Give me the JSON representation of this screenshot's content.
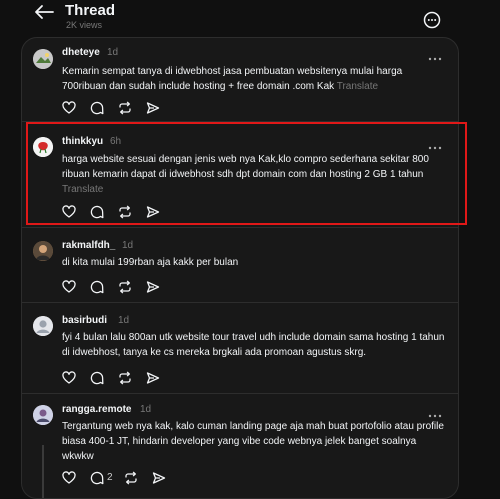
{
  "header": {
    "title": "Thread",
    "views": "2K views"
  },
  "posts": [
    {
      "username": "dheteye",
      "time": "1d",
      "text": "Kemarin sempat tanya di idwebhost jasa pembuatan websitenya mulai harga 700ribuan dan sudah include hosting + free domain .com Kak",
      "translate": "Translate"
    },
    {
      "username": "thinkkyu",
      "time": "6h",
      "text": "harga website sesuai dengan jenis web nya Kak,klo compro sederhana sekitar 800 ribuan kemarin dapat di idwebhost sdh dpt domain com dan hosting 2 GB 1 tahun",
      "translate": "Translate"
    },
    {
      "username": "rakmalfdh_",
      "time": "1d",
      "text": "di kita mulai 199rban aja kakk per bulan"
    },
    {
      "username": "basirbudi",
      "time": "1d",
      "text": "fyi 4 bulan lalu 800an utk website tour travel udh include domain sama hosting 1 tahun di idwebhost, tanya ke cs mereka brgkali ada promoan agustus skrg."
    },
    {
      "username": "rangga.remote",
      "time": "1d",
      "text": "Tergantung web nya kak, kalo cuman landing page aja mah buat portofolio atau profile biasa 400-1 JT, hindarin developer yang vibe code webnya jelek banget soalnya wkwkw",
      "reply_count": "2"
    }
  ],
  "icons": {
    "back": "arrow-left-icon",
    "more": "more-circle-icon",
    "post_menu": "three-dots-icon",
    "like": "heart-icon",
    "reply": "comment-icon",
    "repost": "repost-icon",
    "share": "send-icon"
  },
  "colors": {
    "background": "#101010",
    "panel": "#181818",
    "text": "#f3f5f7",
    "muted": "#777777",
    "highlight_box": "#e01818"
  }
}
